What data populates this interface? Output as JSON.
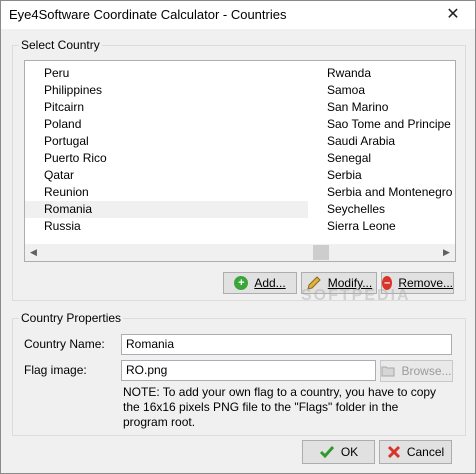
{
  "window": {
    "title": "Eye4Software Coordinate Calculator - Countries",
    "close_glyph": "✕"
  },
  "select_country": {
    "group_label": "Select Country",
    "column1": [
      "Peru",
      "Philippines",
      "Pitcairn",
      "Poland",
      "Portugal",
      "Puerto Rico",
      "Qatar",
      "Reunion",
      "Romania",
      "Russia"
    ],
    "column2": [
      "Rwanda",
      "Samoa",
      "San Marino",
      "Sao Tome and Principe",
      "Saudi Arabia",
      "Senegal",
      "Serbia",
      "Serbia and Montenegro",
      "Seychelles",
      "Sierra Leone"
    ],
    "selected": "Romania",
    "add_label": "Add...",
    "modify_label": "Modify...",
    "remove_label": "Remove..."
  },
  "country_properties": {
    "group_label": "Country Properties",
    "name_label": "Country Name:",
    "name_value": "Romania",
    "flag_label": "Flag image:",
    "flag_value": "RO.png",
    "browse_label": "Browse...",
    "note": "NOTE: To add your own flag to a country, you have to copy the 16x16 pixels PNG file to the \"Flags\" folder in the program root."
  },
  "footer": {
    "ok_label": "OK",
    "cancel_label": "Cancel"
  },
  "watermark": "SOFTPEDIA",
  "icons": {
    "add": "plus-circle-icon",
    "modify": "pencil-icon",
    "remove": "minus-circle-icon",
    "browse": "folder-icon",
    "ok": "checkmark-icon",
    "cancel": "cross-icon"
  },
  "colors": {
    "add": "#3aa63a",
    "remove": "#d9342b",
    "ok": "#2e9a2e",
    "cancel": "#d9342b",
    "modify": "#e0b040"
  }
}
